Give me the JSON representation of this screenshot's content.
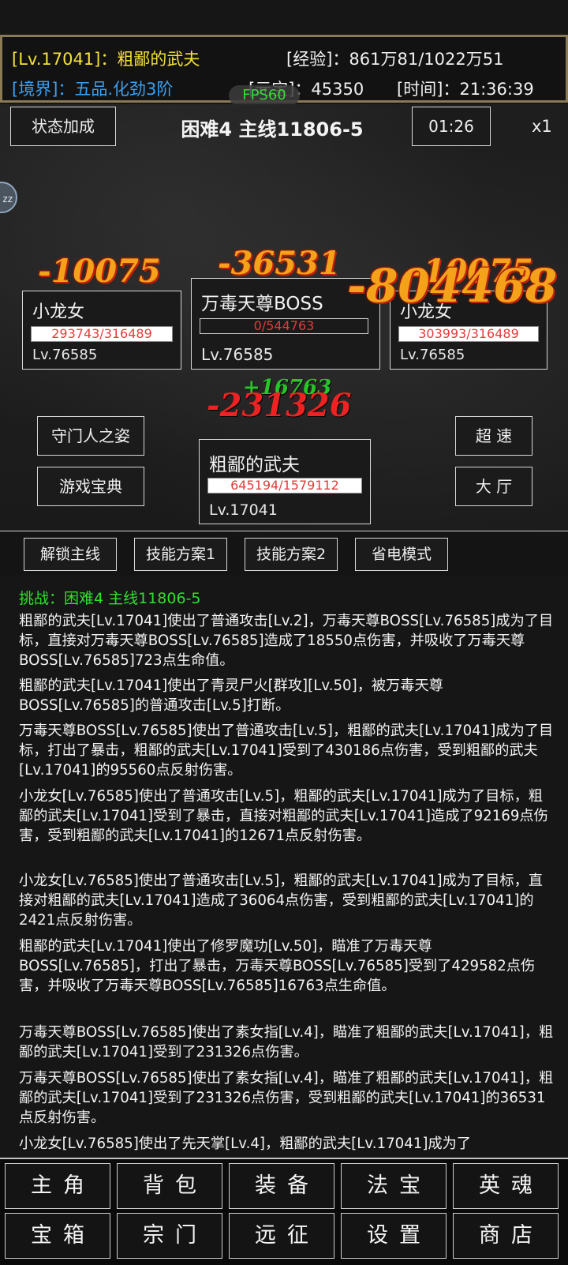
{
  "header": {
    "level_name": "[Lv.17041]：粗鄙的武夫",
    "exp": "[经验]：861万81/1022万51",
    "realm": "[境界]：五品.化劲3阶",
    "yuanbao": "[元宝]：45350",
    "time": "[时间]：21:36:39",
    "fps": "FPS60"
  },
  "battle_bar": {
    "status_button": "状态加成",
    "stage_title": "困难4 主线11806-5",
    "timer": "01:26",
    "speed": "x1",
    "side_badge": "zz"
  },
  "units": {
    "left_ally": {
      "name": "小龙女",
      "hp": "293743/316489",
      "level": "Lv.76585"
    },
    "boss": {
      "name": "万毒天尊BOSS",
      "hp": "0/544763",
      "level": "Lv.76585"
    },
    "right_ally": {
      "name": "小龙女",
      "hp": "303993/316489",
      "level": "Lv.76585"
    },
    "player": {
      "name": "粗鄙的武夫",
      "hp": "645194/1579112",
      "level": "Lv.17041"
    }
  },
  "damage_numbers": {
    "d1": "-10075",
    "d2": "-36531",
    "d3": "-10075",
    "d4": "-804468",
    "heal": "+16763",
    "d5": "-231326"
  },
  "side_buttons": {
    "gatekeeper": "守门人之姿",
    "guide": "游戏宝典",
    "super_speed": "超 速",
    "lobby": "大 厅"
  },
  "tabs": [
    "解锁主线",
    "技能方案1",
    "技能方案2",
    "省电模式"
  ],
  "log": {
    "header": "挑战：困难4 主线11806-5",
    "lines": [
      "粗鄙的武夫[Lv.17041]使出了普通攻击[Lv.2]，万毒天尊BOSS[Lv.76585]成为了目标，直接对万毒天尊BOSS[Lv.76585]造成了18550点伤害，并吸收了万毒天尊BOSS[Lv.76585]723点生命值。",
      "粗鄙的武夫[Lv.17041]使出了青灵尸火[群攻][Lv.50]，被万毒天尊BOSS[Lv.76585]的普通攻击[Lv.5]打断。",
      "万毒天尊BOSS[Lv.76585]使出了普通攻击[Lv.5]，粗鄙的武夫[Lv.17041]成为了目标，打出了暴击，粗鄙的武夫[Lv.17041]受到了430186点伤害，受到粗鄙的武夫[Lv.17041]的95560点反射伤害。",
      "小龙女[Lv.76585]使出了普通攻击[Lv.5]，粗鄙的武夫[Lv.17041]成为了目标，粗鄙的武夫[Lv.17041]受到了暴击，直接对粗鄙的武夫[Lv.17041]造成了92169点伤害，受到粗鄙的武夫[Lv.17041]的12671点反射伤害。",
      "小龙女[Lv.76585]使出了普通攻击[Lv.5]，粗鄙的武夫[Lv.17041]成为了目标，直接对粗鄙的武夫[Lv.17041]造成了36064点伤害，受到粗鄙的武夫[Lv.17041]的2421点反射伤害。",
      "粗鄙的武夫[Lv.17041]使出了修罗魔功[Lv.50]，瞄准了万毒天尊BOSS[Lv.76585]，打出了暴击，万毒天尊BOSS[Lv.76585]受到了429582点伤害，并吸收了万毒天尊BOSS[Lv.76585]16763点生命值。",
      "万毒天尊BOSS[Lv.76585]使出了素女指[Lv.4]，瞄准了粗鄙的武夫[Lv.17041]，粗鄙的武夫[Lv.17041]受到了231326点伤害。",
      "万毒天尊BOSS[Lv.76585]使出了素女指[Lv.4]，瞄准了粗鄙的武夫[Lv.17041]，粗鄙的武夫[Lv.17041]受到了231326点伤害，受到粗鄙的武夫[Lv.17041]的36531点反射伤害。",
      "小龙女[Lv.76585]使出了先天掌[Lv.4]，粗鄙的武夫[Lv.17041]成为了"
    ]
  },
  "nav": {
    "row1": [
      "主角",
      "背包",
      "装备",
      "法宝",
      "英魂"
    ],
    "row2": [
      "宝箱",
      "宗门",
      "远征",
      "设置",
      "商店"
    ]
  },
  "colors": {
    "exp_yellow": "#f4e03a",
    "realm_blue": "#3aa0f0",
    "log_green": "#2fe02f",
    "hp_red": "#e23b3b",
    "frame_gold": "#8a7a56"
  }
}
